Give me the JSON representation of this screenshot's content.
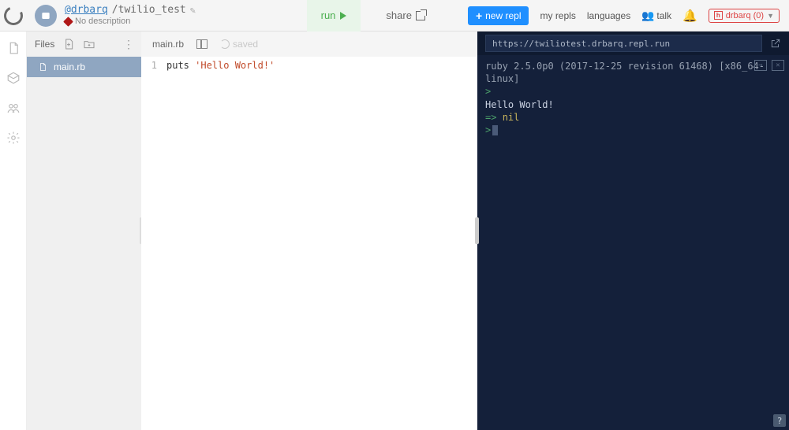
{
  "header": {
    "user_handle": "@drbarq",
    "path_sep": "/",
    "project_name": "twilio_test",
    "description": "No description"
  },
  "actions": {
    "run_label": "run",
    "share_label": "share",
    "new_repl_label": "new repl",
    "my_repls_label": "my repls",
    "languages_label": "languages",
    "talk_label": "talk",
    "user_chip": "drbarq (0)"
  },
  "filepanel": {
    "title": "Files",
    "items": [
      "main.rb"
    ]
  },
  "editor": {
    "tab_name": "main.rb",
    "saved_label": "saved",
    "gutter_line": "1",
    "code_kw": "puts ",
    "code_str": "'Hello World!'"
  },
  "console": {
    "url": "https://twiliotest.drbarq.repl.run",
    "version_line": "ruby 2.5.0p0 (2017-12-25 revision 61468) [x86_64-linux]",
    "output_line": "Hello World!",
    "result_prefix": "=> ",
    "result_value": "nil",
    "close_glyph": "✕",
    "arrow_glyph": "→"
  },
  "help_glyph": "?"
}
